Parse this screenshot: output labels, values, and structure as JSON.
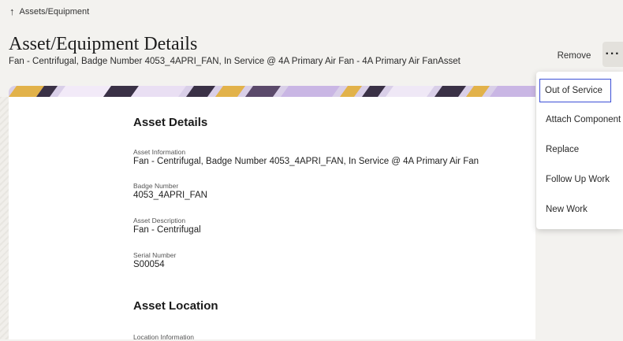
{
  "breadcrumb": {
    "arrow": "↑",
    "label": "Assets/Equipment"
  },
  "header": {
    "title": "Asset/Equipment Details",
    "subtitle": "Fan - Centrifugal, Badge Number 4053_4APRI_FAN, In Service @ 4A Primary Air Fan - 4A Primary Air FanAsset",
    "remove_label": "Remove",
    "more_label": "···"
  },
  "details": {
    "section_title": "Asset Details",
    "fields": [
      {
        "label": "Asset Information",
        "value": "Fan - Centrifugal, Badge Number 4053_4APRI_FAN, In Service @ 4A Primary Air Fan"
      },
      {
        "label": "Badge Number",
        "value": "4053_4APRI_FAN"
      },
      {
        "label": "Asset Description",
        "value": "Fan - Centrifugal"
      },
      {
        "label": "Serial Number",
        "value": "S00054"
      }
    ]
  },
  "location": {
    "section_title": "Asset Location",
    "fields": [
      {
        "label": "Location Information"
      }
    ]
  },
  "menu": {
    "items": [
      {
        "label": "Out of Service"
      },
      {
        "label": "Attach Component"
      },
      {
        "label": "Replace"
      },
      {
        "label": "Follow Up Work"
      },
      {
        "label": "New Work"
      }
    ]
  },
  "colors": {
    "focus_outline": "#3c4fd6",
    "banner_purple": "#c9b6e4",
    "banner_gold": "#e2b24a",
    "banner_dark": "#3a3146"
  }
}
